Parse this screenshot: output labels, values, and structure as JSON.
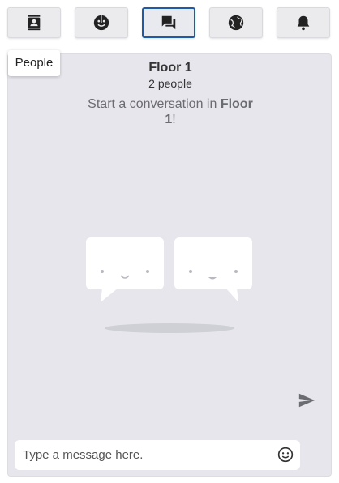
{
  "tabs": [
    {
      "name": "people",
      "icon": "contact-book-icon"
    },
    {
      "name": "emoji",
      "icon": "emoji-face-icon"
    },
    {
      "name": "chat",
      "icon": "chat-bubbles-icon",
      "active": true
    },
    {
      "name": "globe",
      "icon": "globe-icon"
    },
    {
      "name": "notifications",
      "icon": "bell-icon"
    }
  ],
  "tooltip": {
    "label": "People"
  },
  "chat": {
    "room_name": "Floor 1",
    "member_count": "2 people",
    "intro_prefix": "Start a conversation in ",
    "intro_room": "Floor 1",
    "intro_suffix": "!"
  },
  "composer": {
    "placeholder": "Type a message here.",
    "emoji_icon": "smiley-icon",
    "send_icon": "send-arrow-icon"
  },
  "colors": {
    "active_tab_border": "#1f5aa6",
    "panel_bg": "#e6e6ec",
    "icon_color": "#222222"
  }
}
